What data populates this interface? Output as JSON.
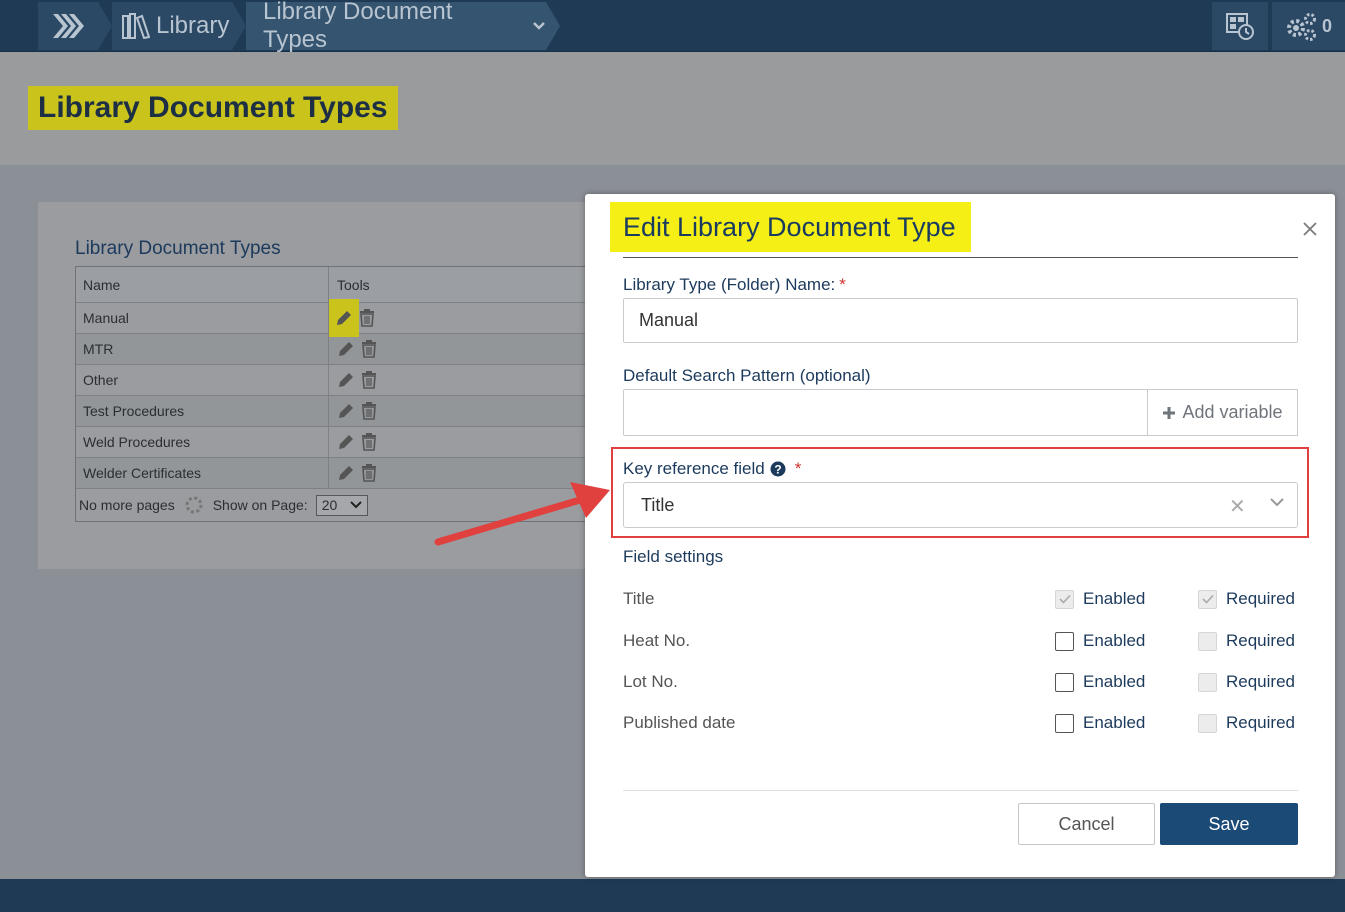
{
  "topbar": {
    "breadcrumbs": [
      "Library",
      "Library Document Types"
    ],
    "notification_count": "0",
    "icons": [
      "nav-menu-icon",
      "library-books-icon",
      "dropdown-chevron-icon",
      "dashboard-clock-icon",
      "settings-gears-icon"
    ]
  },
  "page": {
    "title": "Library Document Types"
  },
  "list_panel": {
    "title": "Library Document Types",
    "columns": [
      "Name",
      "Tools"
    ],
    "rows": [
      "Manual",
      "MTR",
      "Other",
      "Test Procedures",
      "Weld Procedures",
      "Welder Certificates"
    ],
    "footer": {
      "pages_text": "No more pages",
      "show_on_page_label": "Show on Page:",
      "page_size": "20"
    }
  },
  "modal": {
    "title": "Edit Library Document Type",
    "name_label": "Library Type (Folder) Name:",
    "name_value": "Manual",
    "search_pattern_label": "Default Search Pattern (optional)",
    "search_pattern_value": "",
    "add_variable_label": "Add variable",
    "key_field_label": "Key reference field",
    "key_field_value": "Title",
    "field_settings_label": "Field settings",
    "enabled_label": "Enabled",
    "required_label": "Required",
    "fields": [
      {
        "name": "Title",
        "enabled": true,
        "required": true,
        "disabled": true
      },
      {
        "name": "Heat No.",
        "enabled": false,
        "required": false,
        "disabled": false
      },
      {
        "name": "Lot No.",
        "enabled": false,
        "required": false,
        "disabled": false
      },
      {
        "name": "Published date",
        "enabled": false,
        "required": false,
        "disabled": false
      }
    ],
    "cancel_label": "Cancel",
    "save_label": "Save"
  },
  "colors": {
    "topbar": "#1f3a55",
    "highlight_yellow": "#f5ef16",
    "accent_blue": "#1b4a77",
    "annotation_red": "#e0403e"
  }
}
